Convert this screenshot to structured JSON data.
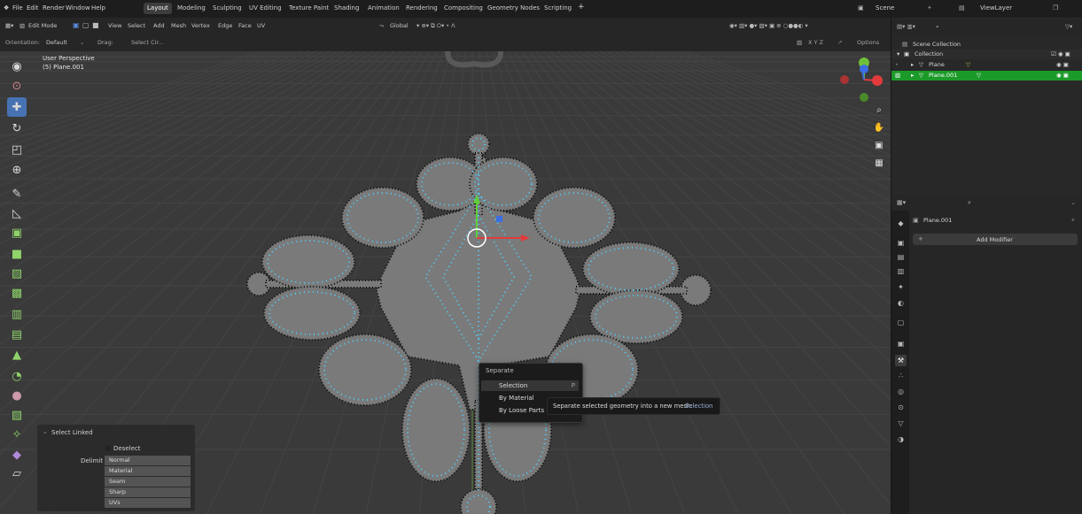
{
  "menu": {
    "items": [
      "File",
      "Edit",
      "Render",
      "Window",
      "Help"
    ],
    "workspaces": [
      "Layout",
      "Modeling",
      "Sculpting",
      "UV Editing",
      "Texture Paint",
      "Shading",
      "Animation",
      "Rendering",
      "Compositing",
      "Geometry Nodes",
      "Scripting"
    ],
    "active_workspace": "Layout",
    "add_tab": "+",
    "scene": "Scene",
    "view_layer": "ViewLayer"
  },
  "header": {
    "mode": "Edit Mode",
    "menus": [
      "View",
      "Select",
      "Add",
      "Mesh",
      "Vertex",
      "Edge",
      "Face",
      "UV"
    ],
    "transform_orientation": "Global",
    "axes": "X Y Z",
    "options": "Options"
  },
  "toolsettings": {
    "orientation_label": "Orientation:",
    "orientation_value": "Default",
    "drag_label": "Drag:",
    "drag_value": "Select Cir..."
  },
  "viewport": {
    "view_name": "User Perspective",
    "object_name": "(5) Plane.001"
  },
  "context_menu": {
    "title": "Separate",
    "items": [
      {
        "label": "Selection",
        "key": "P"
      },
      {
        "label": "By Material",
        "key": ""
      },
      {
        "label": "By Loose Parts",
        "key": ""
      }
    ]
  },
  "tooltip": {
    "text": "Separate selected geometry into a new mesh:",
    "value": "Selection"
  },
  "operator_panel": {
    "title": "Select Linked",
    "deselect": "Deselect",
    "delimit_label": "Delimit",
    "delimit_options": [
      "Normal",
      "Material",
      "Seam",
      "Sharp",
      "UVs"
    ]
  },
  "outliner": {
    "root": "Scene Collection",
    "collection": "Collection",
    "objects": [
      "Plane",
      "Plane.001"
    ],
    "selected": "Plane.001"
  },
  "properties": {
    "object_name": "Plane.001",
    "add_modifier": "Add Modifier"
  },
  "colors": {
    "accent": "#4772b3",
    "selected_row": "#1c9a29",
    "mesh_face": "#7a7a7a",
    "vertex_selected": "#4fd0ff"
  }
}
